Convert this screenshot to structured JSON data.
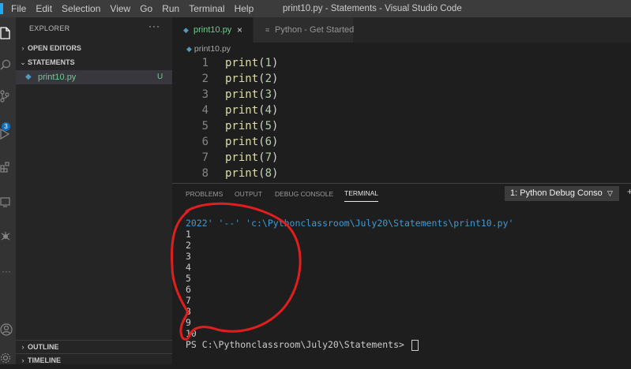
{
  "menubar": {
    "items": [
      "File",
      "Edit",
      "Selection",
      "View",
      "Go",
      "Run",
      "Terminal",
      "Help"
    ],
    "window_title": "print10.py - Statements - Visual Studio Code"
  },
  "activity_bar": {
    "icons": [
      "explorer-icon",
      "search-icon",
      "source-control-icon",
      "run-debug-icon",
      "extensions-icon",
      "remote-icon",
      "testing-icon",
      "more-icon",
      "account-icon",
      "settings-icon"
    ],
    "source_control_badge": "3"
  },
  "sidebar": {
    "header": "EXPLORER",
    "more_label": "···",
    "open_editors": "OPEN EDITORS",
    "folder": "STATEMENTS",
    "file": {
      "name": "print10.py",
      "status": "U"
    },
    "outline": "OUTLINE",
    "timeline": "TIMELINE"
  },
  "tabs": [
    {
      "label": "print10.py",
      "close": "×",
      "active": true
    },
    {
      "label": "Python - Get Started",
      "active": false
    }
  ],
  "breadcrumb": "print10.py",
  "editor": {
    "lines": [
      {
        "number": "1",
        "fn": "print",
        "arg": "1"
      },
      {
        "number": "2",
        "fn": "print",
        "arg": "2"
      },
      {
        "number": "3",
        "fn": "print",
        "arg": "3"
      },
      {
        "number": "4",
        "fn": "print",
        "arg": "4"
      },
      {
        "number": "5",
        "fn": "print",
        "arg": "5"
      },
      {
        "number": "6",
        "fn": "print",
        "arg": "6"
      },
      {
        "number": "7",
        "fn": "print",
        "arg": "7"
      },
      {
        "number": "8",
        "fn": "print",
        "arg": "8"
      }
    ]
  },
  "panel": {
    "tabs": [
      "PROBLEMS",
      "OUTPUT",
      "DEBUG CONSOLE",
      "TERMINAL"
    ],
    "active_tab": "TERMINAL",
    "terminal_select": "1: Python Debug Conso",
    "terminal_command": "2022' '--' 'c:\\Pythonclassroom\\July20\\Statements\\print10.py'",
    "terminal_output": [
      "1",
      "2",
      "3",
      "4",
      "5",
      "6",
      "7",
      "8",
      "9",
      "10"
    ],
    "prompt": "PS C:\\Pythonclassroom\\July20\\Statements> "
  },
  "colors": {
    "annotation_circle": "#e01e1e",
    "untracked_file": "#73c991",
    "python_icon": "#519aba"
  }
}
